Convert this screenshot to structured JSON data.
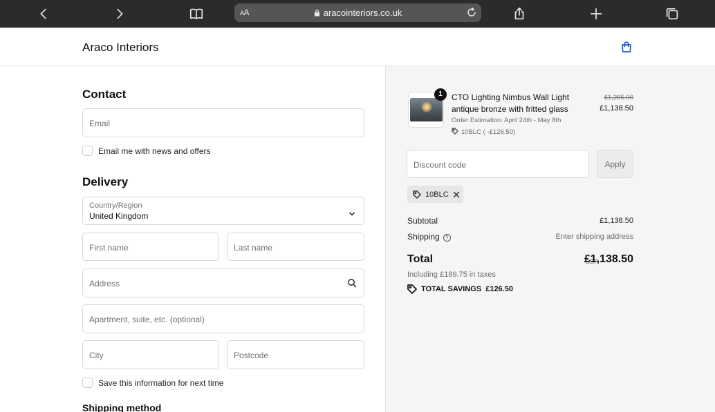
{
  "browser": {
    "url_aa": "AA",
    "url": "aracointeriors.co.uk",
    "icons": [
      "back-icon",
      "forward-icon",
      "bookmarks-icon",
      "lock-icon",
      "reload-icon",
      "share-icon",
      "new-tab-icon",
      "tabs-icon"
    ]
  },
  "header": {
    "brand": "Araco Interiors",
    "cart_icon": "shopping-bag-icon",
    "accent_color": "#1a5fd0"
  },
  "contact": {
    "title": "Contact",
    "email_placeholder": "Email",
    "newsletter_label": "Email me with news and offers"
  },
  "delivery": {
    "title": "Delivery",
    "country_label": "Country/Region",
    "country_value": "United Kingdom",
    "first_name_placeholder": "First name",
    "last_name_placeholder": "Last name",
    "address_placeholder": "Address",
    "apartment_placeholder": "Apartment, suite, etc. (optional)",
    "city_placeholder": "City",
    "postcode_placeholder": "Postcode",
    "save_info_label": "Save this information for next time"
  },
  "shipping_method": {
    "title": "Shipping method"
  },
  "summary": {
    "item": {
      "quantity": "1",
      "name": "CTO Lighting Nimbus Wall Light antique bronze with fritted glass",
      "estimation": "Order Estimation: April 24th - May 8th",
      "discount": "10BLC ( -£126.50)",
      "original_price": "£1,265.00",
      "price": "£1,138.50"
    },
    "discount_placeholder": "Discount code",
    "apply_label": "Apply",
    "applied_code": "10BLC",
    "subtotal_label": "Subtotal",
    "subtotal_value": "£1,138.50",
    "shipping_label": "Shipping",
    "shipping_value": "Enter shipping address",
    "total_label": "Total",
    "total_currency": "GBP",
    "total_value": "£1,138.50",
    "tax_note": "Including £189.75 in taxes",
    "savings_label": "TOTAL SAVINGS",
    "savings_value": "£126.50"
  }
}
